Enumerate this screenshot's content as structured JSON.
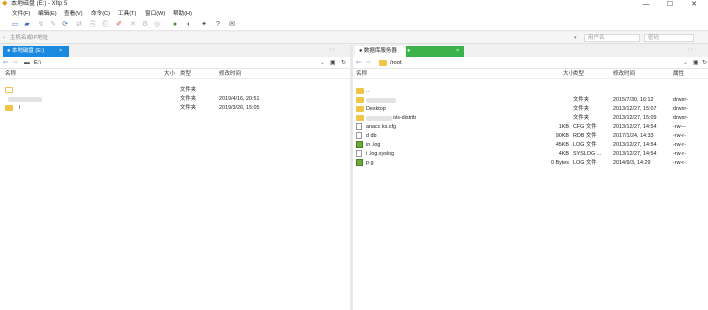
{
  "window": {
    "title": "本地磁盘 (E:) - Xftp 5",
    "buttons": [
      "—",
      "☐",
      "✕"
    ]
  },
  "menu": [
    "文件(F)",
    "编辑(E)",
    "查看(V)",
    "命令(C)",
    "工具(T)",
    "窗口(W)",
    "帮助(H)"
  ],
  "address": {
    "placeholder": "主机名或IP地址",
    "username_placeholder": "用户名",
    "password_placeholder": "密码"
  },
  "left_pane": {
    "tab_label": "● 本地磁盘 (E:)",
    "tab_close": "×",
    "path": "E:\\",
    "columns": [
      "名称",
      "大小",
      "类型",
      "修改时间"
    ],
    "rows": [
      {
        "name": "",
        "size": "",
        "type": "文件夹",
        "modified": ""
      },
      {
        "name": "",
        "size": "",
        "type": "文件夹",
        "modified": "2019/4/16, 20:51"
      },
      {
        "name": "l",
        "size": "",
        "type": "文件夹",
        "modified": "2019/3/26, 15:05"
      }
    ]
  },
  "right_pane": {
    "tab_label": "● 数据库服务器",
    "tab_close": "×",
    "path": "/root",
    "columns": [
      "名称",
      "大小",
      "类型",
      "修改时间",
      "属性"
    ],
    "rows": [
      {
        "icon": "folder",
        "name": "..",
        "size": "",
        "type": "",
        "modified": "",
        "attrs": ""
      },
      {
        "icon": "folder",
        "name": "",
        "size": "",
        "type": "文件夹",
        "modified": "2015/7/30, 16:12",
        "attrs": "drwxr-"
      },
      {
        "icon": "folder",
        "name": "Desktop",
        "size": "",
        "type": "文件夹",
        "modified": "2013/12/27, 15:07",
        "attrs": "drwxr-"
      },
      {
        "icon": "folder",
        "name": "ols-distrib",
        "size": "",
        "type": "文件夹",
        "modified": "2013/12/27, 15:09",
        "attrs": "drwxr-"
      },
      {
        "icon": "file",
        "name": "anacc      ks.cfg",
        "size": "1KB",
        "type": "CFG 文件",
        "modified": "2013/12/27, 14:54",
        "attrs": "-rw---"
      },
      {
        "icon": "file",
        "name": "d      db",
        "size": "90KB",
        "type": "RDB 文件",
        "modified": "2017/1/24, 14:33",
        "attrs": "-rw-r-"
      },
      {
        "icon": "log",
        "name": "in      .log",
        "size": "45KB",
        "type": "LOG 文件",
        "modified": "2013/12/27, 14:54",
        "attrs": "-rw-r-"
      },
      {
        "icon": "file",
        "name": "i       .log.syslog",
        "size": "4KB",
        "type": "SYSLOG ...",
        "modified": "2013/12/27, 14:54",
        "attrs": "-rw-r-"
      },
      {
        "icon": "log",
        "name": "p      g",
        "size": "0 Bytes",
        "type": "LOG 文件",
        "modified": "2014/9/3, 14:29",
        "attrs": "-rw-r-"
      }
    ]
  },
  "colors": {
    "tab_blue": "#1a8ae0",
    "tab_green": "#0c9b4a",
    "folder": "#f3c44a",
    "app_icon": "#e09c17"
  }
}
